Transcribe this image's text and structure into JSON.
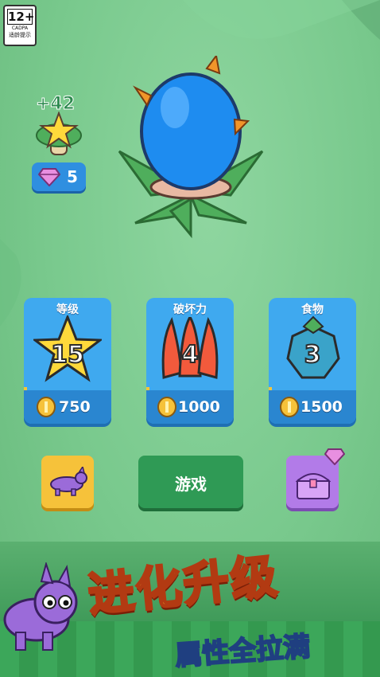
{
  "age_badge": {
    "rating": "12+",
    "org": "CADPA",
    "label": "适龄提示"
  },
  "pickup": {
    "plus_text": "+42"
  },
  "gems": {
    "count": "5"
  },
  "cards": [
    {
      "title": "等级",
      "level": "15",
      "cost": "750"
    },
    {
      "title": "破坏力",
      "level": "4",
      "cost": "1000"
    },
    {
      "title": "食物",
      "level": "3",
      "cost": "1500"
    }
  ],
  "buttons": {
    "play_label": "游戏"
  },
  "banner": {
    "headline": "进化升级",
    "subline": "属性全拉满"
  },
  "colors": {
    "card_blue": "#3fa9ef",
    "play_green": "#2f9a55",
    "pet_yellow": "#f6c23a",
    "chest_purple": "#b27be8"
  }
}
